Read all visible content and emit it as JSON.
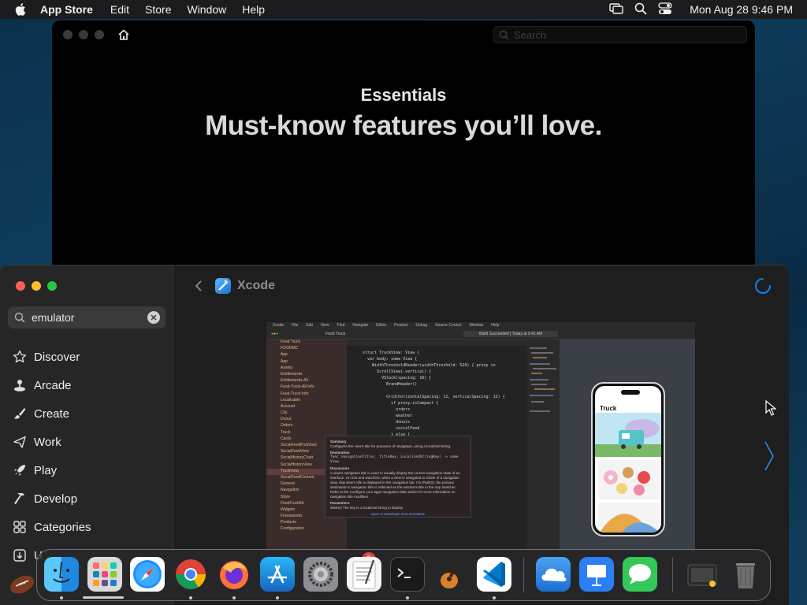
{
  "menubar": {
    "app_name": "App Store",
    "items": [
      "Edit",
      "Store",
      "Window",
      "Help"
    ],
    "clock": "Mon Aug 28  9:46 PM",
    "status_icons": [
      "screen-mirroring-icon",
      "spotlight-search-icon",
      "control-center-icon"
    ]
  },
  "back_window": {
    "search_placeholder": "Search",
    "eyebrow": "Essentials",
    "headline": "Must-know features you’ll love."
  },
  "front_window": {
    "search": {
      "value": "emulator"
    },
    "nav": [
      {
        "label": "Discover",
        "icon": "star-icon"
      },
      {
        "label": "Arcade",
        "icon": "joystick-icon"
      },
      {
        "label": "Create",
        "icon": "paintbrush-icon"
      },
      {
        "label": "Work",
        "icon": "paper-plane-icon"
      },
      {
        "label": "Play",
        "icon": "rocket-icon"
      },
      {
        "label": "Develop",
        "icon": "hammer-icon"
      },
      {
        "label": "Categories",
        "icon": "grid-icon"
      },
      {
        "label": "U",
        "icon": "download-icon"
      }
    ],
    "app_name": "Xcode"
  },
  "xcode_screenshot": {
    "menu": [
      "Xcode",
      "File",
      "Edit",
      "View",
      "Find",
      "Navigate",
      "Editor",
      "Product",
      "Debug",
      "Source Control",
      "Window",
      "Help"
    ],
    "project": "Food Truck",
    "status": "Build Succeeded | Today at 9:41 AM",
    "preview_title": "Truck",
    "navigator": [
      "Food Truck",
      "FOODMC",
      "App",
      "App",
      "Assets",
      "Entitlements",
      "Entitlements-All",
      "Food-Truck-All-Info",
      "Food-Truck-Info",
      "Localizable",
      "Account",
      "City",
      "Donut",
      "Orders",
      "Truck",
      "Cards",
      "SocialFeedPostView",
      "SocialFeedView",
      "SocialHistoryChart",
      "SocialHistoryView",
      "TruckView",
      "SocialFeedContent",
      "General",
      "Navigation",
      "Store",
      "FoodTruckKit",
      "Widgets",
      "Frameworks",
      "Products",
      "Configuration"
    ],
    "code": [
      "struct TruckView: View {",
      "  var body: some View {",
      "    WidthThresholdReader(widthThreshold: 520) { proxy in",
      "      ScrollView(.vertical) {",
      "        VStack(spacing: 16) {",
      "          BrandHeader()",
      "",
      "          Grid(horizontalSpacing: 12, verticalSpacing: 12) {",
      "            if proxy.isCompact {",
      "              orders",
      "              weather",
      "              donuts",
      "              socialFeed",
      "            } else {",
      "              GridRow {",
      "                orders",
      "                weather"
    ],
    "popover": {
      "heading": "Summary",
      "summary": "Configures the view's title for purposes of navigation, using a localized string.",
      "decl_heading": "Declaration",
      "declaration": "func navigationTitle(_ titleKey: LocalizedStringKey) -> some View",
      "disc_heading": "Discussion",
      "discussion": "A view's navigation title is used to visually display the current navigation state of an interface. On iOS and watchOS, when a view is navigated to inside of a navigation view, that view's title is displayed in the navigation bar. On iPadOS, the primary destination's navigation title is reflected as the window's title in the App Switcher.",
      "refer": "Refer to the Configure your apps navigation titles article for more information on navigation title modifiers.",
      "param_heading": "Parameters",
      "param": "titleKey    The key to a localized string to display.",
      "link": "Open in Developer Documentation"
    }
  },
  "dock": {
    "apps": [
      {
        "name": "Finder",
        "icon": "finder-icon"
      },
      {
        "name": "Launchpad",
        "icon": "launchpad-icon"
      },
      {
        "name": "Safari",
        "icon": "safari-icon"
      },
      {
        "name": "Google Chrome",
        "icon": "chrome-icon"
      },
      {
        "name": "Firefox",
        "icon": "firefox-icon"
      },
      {
        "name": "App Store",
        "icon": "app-store-icon"
      },
      {
        "name": "System Settings",
        "icon": "settings-icon",
        "badge": "2"
      },
      {
        "name": "TextEdit",
        "icon": "textedit-icon"
      },
      {
        "name": "Terminal",
        "icon": "terminal-icon"
      },
      {
        "name": "GarageBand",
        "icon": "garageband-icon"
      },
      {
        "name": "Visual Studio Code",
        "icon": "vscode-icon"
      },
      {
        "name": "iCloud",
        "icon": "icloud-icon"
      },
      {
        "name": "Keynote",
        "icon": "keynote-icon"
      },
      {
        "name": "Messages",
        "icon": "messages-icon"
      },
      {
        "name": "Screenshot",
        "icon": "screenshot-icon"
      },
      {
        "name": "Trash",
        "icon": "trash-icon"
      }
    ]
  },
  "colors": {
    "accent": "#0a84ff",
    "traffic_red": "#ff5f57",
    "traffic_yellow": "#febc2e",
    "traffic_green": "#28c840",
    "badge_red": "#e8423f"
  }
}
